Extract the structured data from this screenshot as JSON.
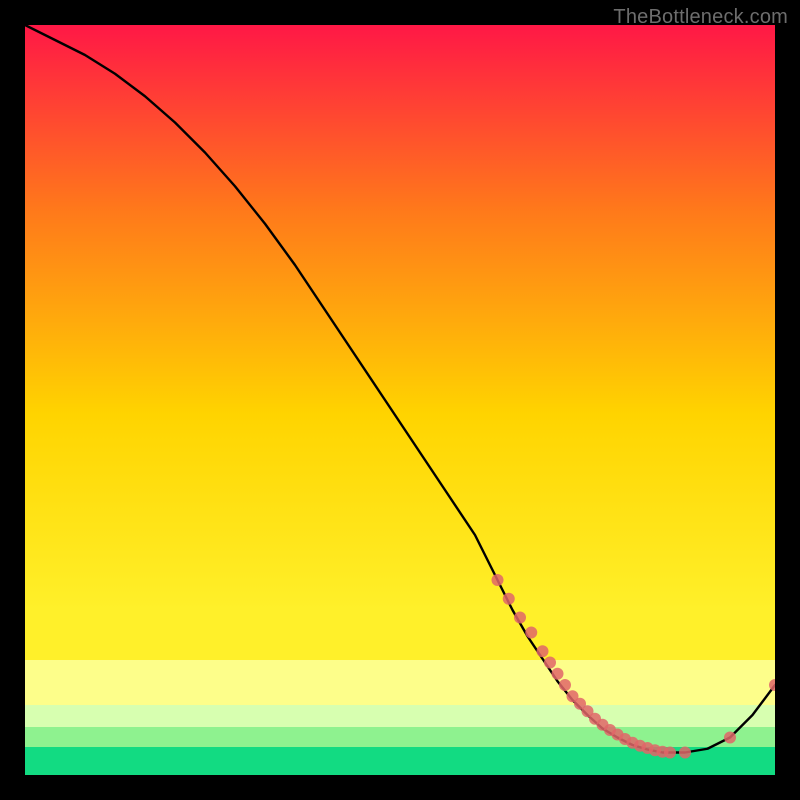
{
  "watermark": "TheBottleneck.com",
  "colors": {
    "top": "#ff1846",
    "mid_upper": "#ff7a1a",
    "mid": "#ffd400",
    "mid_lower": "#fff02a",
    "band_yellow_pale": "#fdfe8a",
    "band_green_pale": "#d7ffb0",
    "band_green_mid": "#8ef28f",
    "band_green_deep": "#12db82",
    "line": "#000000",
    "marker": "#e06668"
  },
  "chart_data": {
    "type": "line",
    "title": "",
    "xlabel": "",
    "ylabel": "",
    "xlim": [
      0,
      100
    ],
    "ylim": [
      0,
      100
    ],
    "series": [
      {
        "name": "curve",
        "x": [
          0,
          4,
          8,
          12,
          16,
          20,
          24,
          28,
          32,
          36,
          40,
          44,
          48,
          52,
          56,
          60,
          63,
          65,
          67,
          69,
          71,
          73,
          75,
          77,
          79,
          81,
          83,
          85,
          88,
          91,
          94,
          97,
          100
        ],
        "y": [
          100,
          98,
          96,
          93.5,
          90.5,
          87,
          83,
          78.5,
          73.5,
          68,
          62,
          56,
          50,
          44,
          38,
          32,
          26,
          22,
          18.5,
          15.5,
          12.5,
          10,
          8,
          6.2,
          5,
          4,
          3.4,
          3,
          3,
          3.5,
          5,
          8,
          12
        ]
      }
    ],
    "markers": {
      "name": "highlight-cluster",
      "x": [
        63,
        64.5,
        66,
        67.5,
        69,
        70,
        71,
        72,
        73,
        74,
        75,
        76,
        77,
        78,
        79,
        80,
        81,
        82,
        83,
        84,
        85,
        86,
        88,
        94,
        100
      ],
      "y": [
        26,
        23.5,
        21,
        19,
        16.5,
        15,
        13.5,
        12,
        10.5,
        9.5,
        8.5,
        7.5,
        6.7,
        6,
        5.4,
        4.8,
        4.3,
        3.9,
        3.6,
        3.3,
        3.1,
        3,
        3,
        5,
        12
      ]
    }
  }
}
